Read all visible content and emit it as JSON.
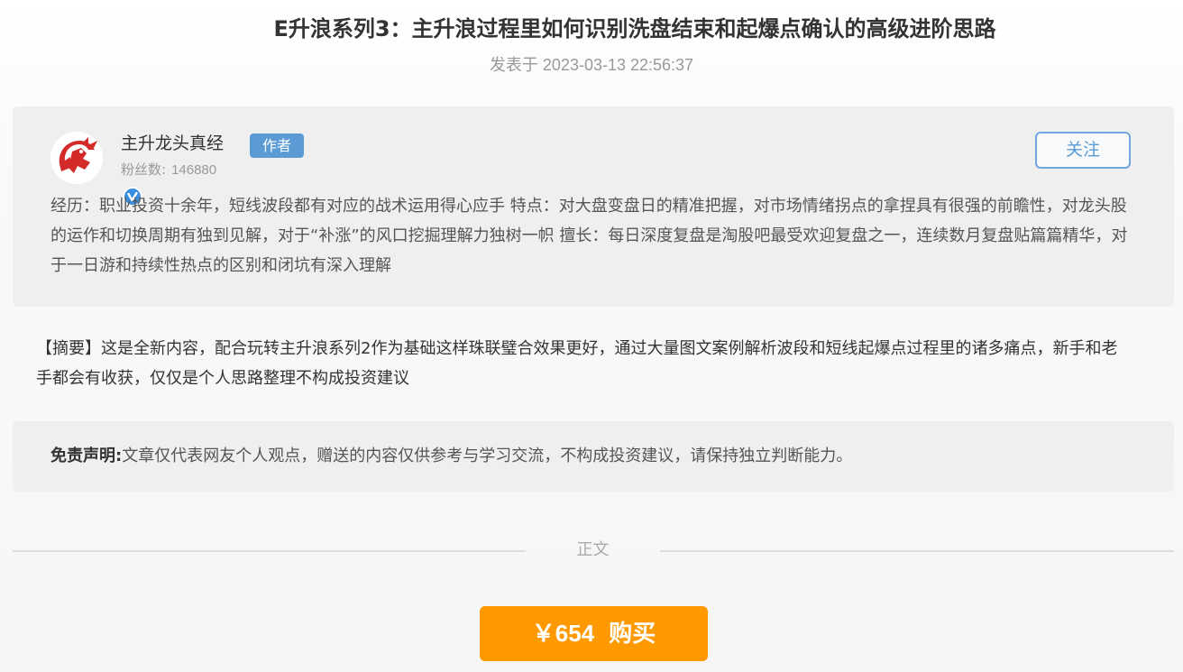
{
  "article": {
    "title": "E升浪系列3：主升浪过程里如何识别洗盘结束和起爆点确认的高级进阶思路",
    "published": "发表于 2023-03-13 22:56:37"
  },
  "author": {
    "name": "主升龙头真经",
    "badge": "作者",
    "fans_label": "粉丝数:",
    "fans_count": "146880",
    "follow_label": "关注",
    "bio": "经历：职业投资十余年，短线波段都有对应的战术运用得心应手 特点：对大盘变盘日的精准把握，对市场情绪拐点的拿捏具有很强的前瞻性，对龙头股的运作和切换周期有独到见解，对于“补涨”的风口挖掘理解力独树一帜 擅长：每日深度复盘是淘股吧最受欢迎复盘之一，连续数月复盘贴篇篇精华，对于一日游和持续性热点的区别和闭坑有深入理解",
    "avatar_icon": "red-dragon-avatar-icon",
    "verified_icon": "verified-v-icon"
  },
  "summary": "【摘要】这是全新内容，配合玩转主升浪系列2作为基础这样珠联璧合效果更好，通过大量图文案例解析波段和短线起爆点过程里的诸多痛点，新手和老手都会有收获，仅仅是个人思路整理不构成投资建议",
  "disclaimer": {
    "label": "免责声明:",
    "text": "文章仅代表网友个人观点，赠送的内容仅供参考与学习交流，不构成投资建议，请保持独立判断能力。"
  },
  "divider": {
    "label": "正文"
  },
  "purchase": {
    "price": "￥654",
    "label": "购买"
  },
  "colors": {
    "accent_blue": "#5a9bd5",
    "buy_orange": "#ff9900",
    "panel_gray": "#efefef"
  }
}
